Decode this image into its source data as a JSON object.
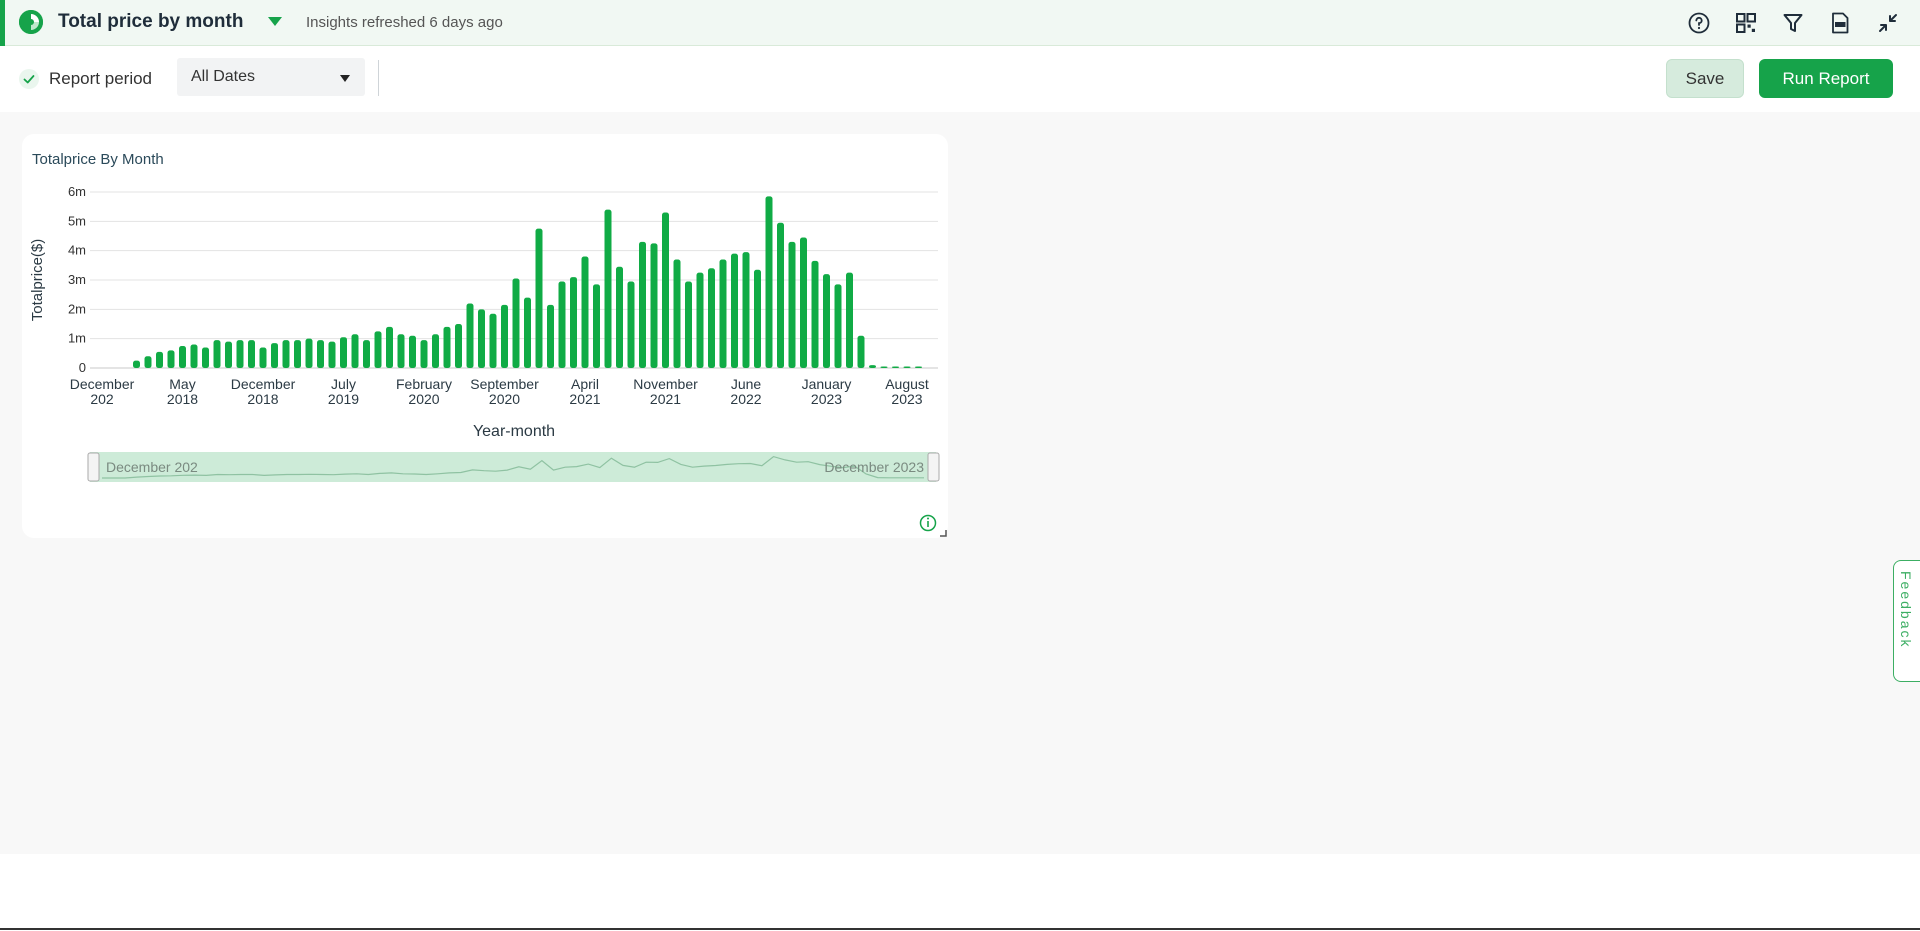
{
  "header": {
    "title": "Total price by month",
    "refreshed": "Insights refreshed 6 days ago",
    "icons": [
      "help-icon",
      "dashboard-grid-icon",
      "filter-icon",
      "pdf-export-icon",
      "collapse-icon"
    ]
  },
  "filters": {
    "period_label": "Report period",
    "period_checked": true,
    "date_value": "All Dates"
  },
  "actions": {
    "save_label": "Save",
    "run_label": "Run Report"
  },
  "feedback_label": "Feedback",
  "colors": {
    "accent": "#16a34a",
    "bar": "#10ab45",
    "header_bg": "#f1f8f3"
  },
  "chart": {
    "title": "Totalprice By Month",
    "chart_data": {
      "type": "bar",
      "title": "Totalprice By Month",
      "xlabel": "Year-month",
      "ylabel": "Totalprice($)",
      "ylim": [
        0,
        6000000
      ],
      "y_ticks": [
        "0",
        "1m",
        "2m",
        "3m",
        "4m",
        "5m",
        "6m"
      ],
      "x_ticks": [
        {
          "month": "December",
          "year": "202",
          "index": 0
        },
        {
          "month": "May",
          "year": "2018",
          "index": 7
        },
        {
          "month": "December",
          "year": "2018",
          "index": 14
        },
        {
          "month": "July",
          "year": "2019",
          "index": 21
        },
        {
          "month": "February",
          "year": "2020",
          "index": 28
        },
        {
          "month": "September",
          "year": "2020",
          "index": 35
        },
        {
          "month": "April",
          "year": "2021",
          "index": 42
        },
        {
          "month": "November",
          "year": "2021",
          "index": 49
        },
        {
          "month": "June",
          "year": "2022",
          "index": 56
        },
        {
          "month": "January",
          "year": "2023",
          "index": 63
        },
        {
          "month": "August",
          "year": "2023",
          "index": 70
        }
      ],
      "values": [
        0,
        0,
        0,
        250000,
        400000,
        550000,
        600000,
        750000,
        800000,
        700000,
        950000,
        900000,
        950000,
        950000,
        700000,
        850000,
        950000,
        950000,
        1000000,
        950000,
        900000,
        1050000,
        1150000,
        950000,
        1250000,
        1400000,
        1150000,
        1100000,
        950000,
        1150000,
        1400000,
        1500000,
        2200000,
        2000000,
        1850000,
        2150000,
        3050000,
        2400000,
        4750000,
        2150000,
        2950000,
        3100000,
        3800000,
        2850000,
        5400000,
        3450000,
        2950000,
        4300000,
        4250000,
        5300000,
        3700000,
        2950000,
        3250000,
        3400000,
        3700000,
        3900000,
        3950000,
        3350000,
        5850000,
        4950000,
        4300000,
        4450000,
        3650000,
        3200000,
        2850000,
        3250000,
        1100000,
        100000,
        50000,
        50000,
        50000,
        50000
      ],
      "grid": true,
      "legend": "none",
      "range_selector": {
        "start_label": "December 202",
        "end_label": "December 2023"
      }
    }
  }
}
